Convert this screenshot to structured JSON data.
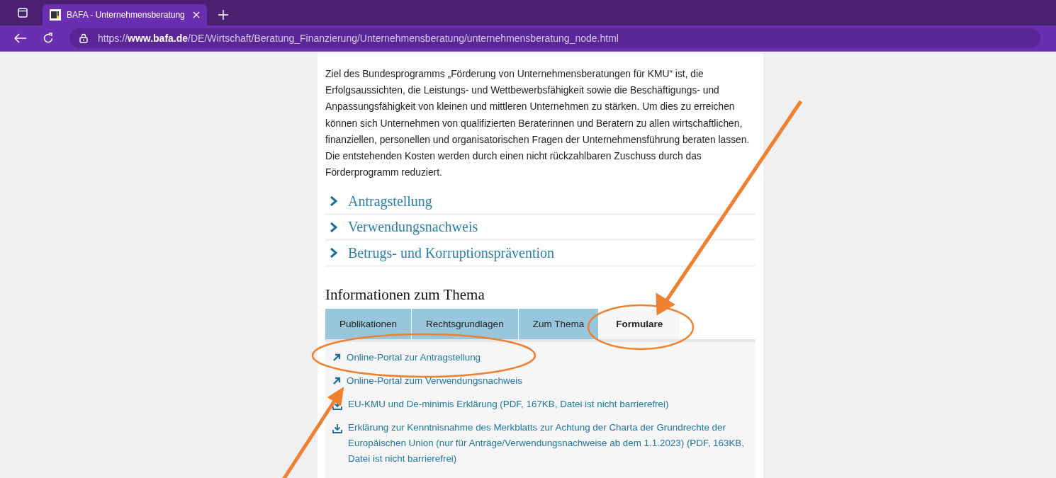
{
  "browser": {
    "tab_title": "BAFA - Unternehmensberatung",
    "url_prefix": "https://",
    "url_host": "www.bafa.de",
    "url_path": "/DE/Wirtschaft/Beratung_Finanzierung/Unternehmensberatung/unternehmensberatung_node.html"
  },
  "intro": "Ziel des Bundesprogramms „Förderung von Unternehmensberatungen für KMU“ ist, die Erfolgsaussichten, die Leistungs- und Wettbewerbsfähigkeit sowie die Beschäftigungs- und Anpassungsfähigkeit von kleinen und mittleren Unternehmen zu stärken. Um dies zu erreichen können sich Unternehmen von qualifizierten Beraterinnen und Beratern zu allen wirtschaftlichen, finanziellen, personellen und organisatorischen Fragen der Unternehmensführung beraten lassen. Die entstehenden Kosten werden durch einen nicht rückzahlbaren Zuschuss durch das Förderprogramm reduziert.",
  "accordion": [
    {
      "label": "Antragstellung",
      "expanded": false
    },
    {
      "label": "Verwendungsnachweis",
      "expanded": false
    },
    {
      "label": "Betrugs- und Korruptionsprävention",
      "expanded": false
    }
  ],
  "section_title": "Informationen zum Thema",
  "tabs": [
    {
      "label": "Publikationen",
      "selected": false
    },
    {
      "label": "Rechtsgrundlagen",
      "selected": false
    },
    {
      "label": "Zum Thema",
      "selected": false
    },
    {
      "label": "Formulare",
      "selected": true
    }
  ],
  "links": [
    {
      "kind": "external",
      "text": "Online-Portal zur Antragstellung"
    },
    {
      "kind": "external",
      "text": "Online-Portal zum Verwendungsnachweis"
    },
    {
      "kind": "download",
      "text": "EU-KMU und De-minimis Erklärung (PDF, 167KB, Datei ist nicht barrierefrei)"
    },
    {
      "kind": "download",
      "text": "Erklärung zur Kenntnisnahme des Merkblatts zur Achtung der Charta der Grundrechte der Europäischen Union (nur für Anträge/Verwendungsnachweise ab dem 1.1.2023) (PDF, 163KB, Datei ist nicht barrierefrei)"
    }
  ]
}
